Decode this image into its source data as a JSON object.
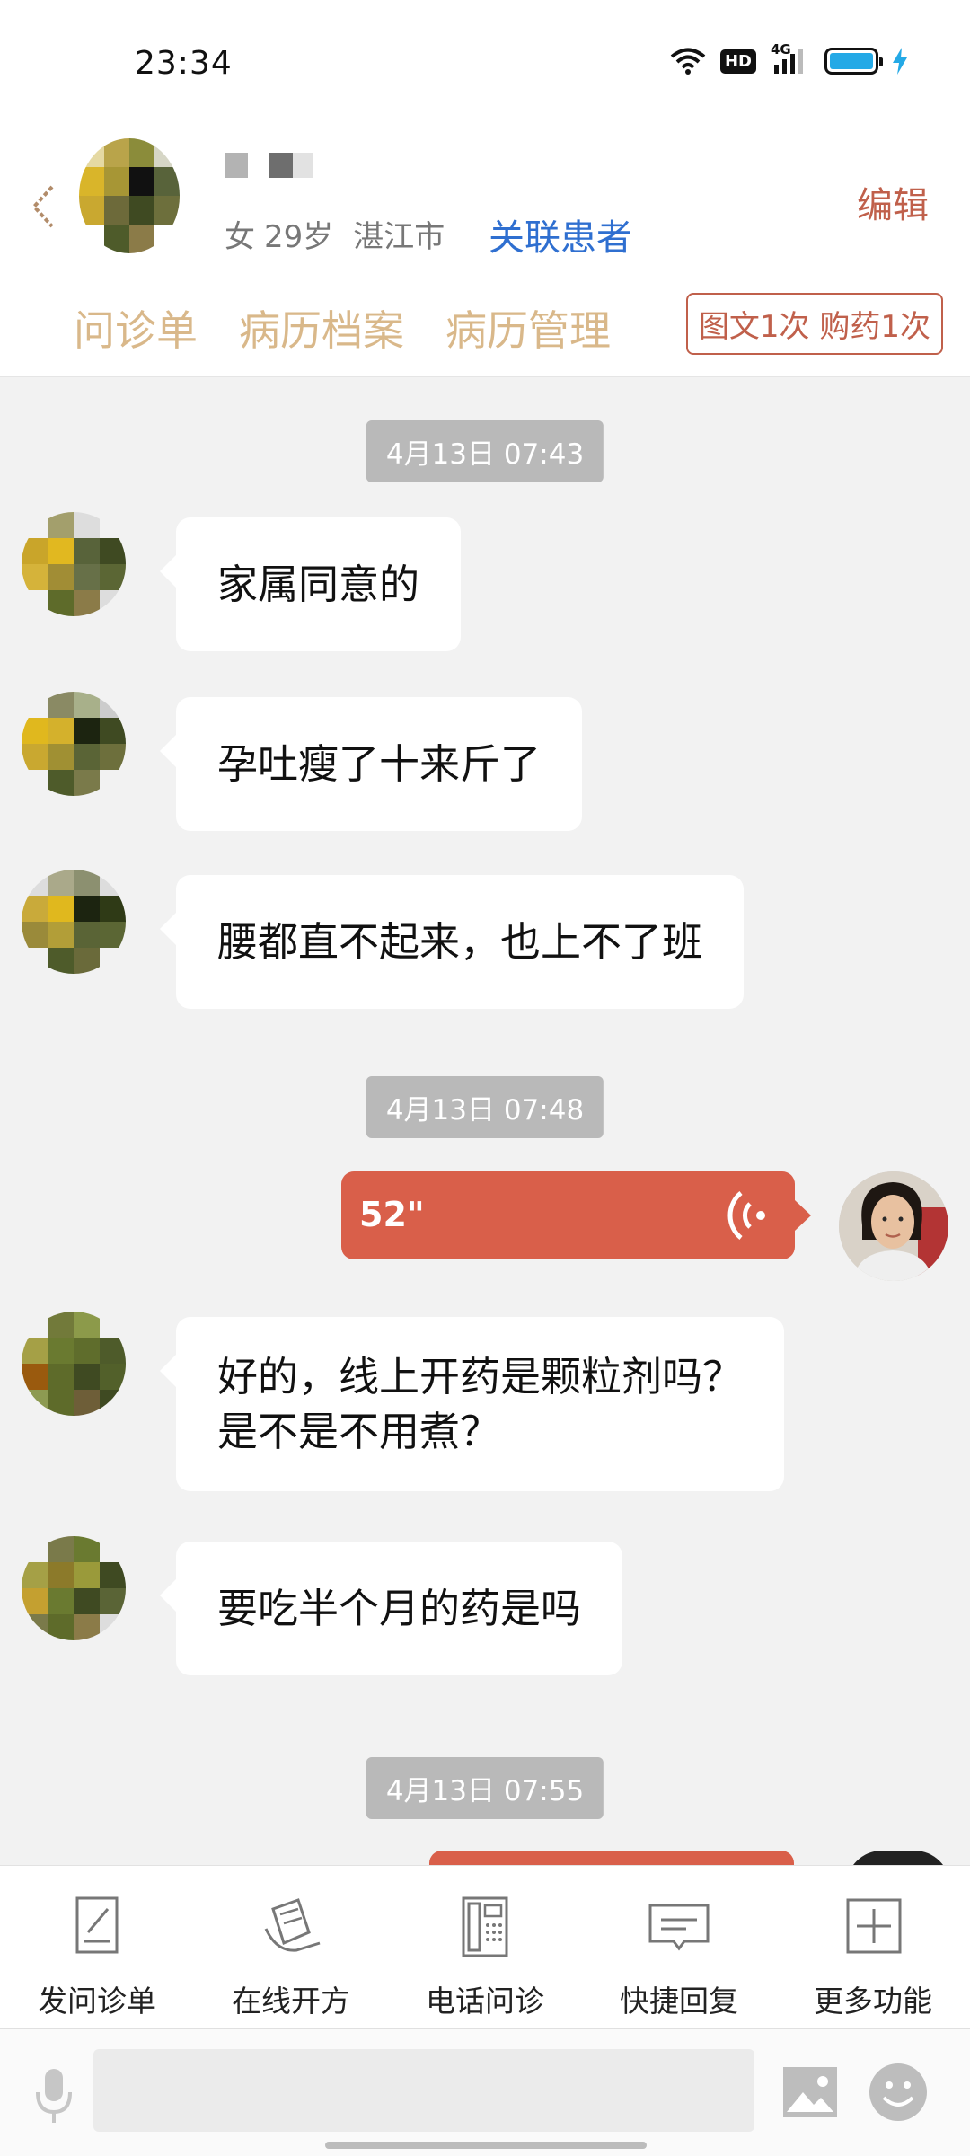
{
  "status_bar": {
    "time": "23:34",
    "hd_label": "HD",
    "network_label": "4G",
    "battery_level": 0.95,
    "battery_color": "#24a9e6"
  },
  "header": {
    "patient_gender": "女",
    "patient_age": "29岁",
    "patient_city": "湛江市",
    "link_patient_label": "关联患者",
    "edit_label": "编辑",
    "tabs": [
      "问诊单",
      "病历档案",
      "病历管理"
    ],
    "quota_label": "图文1次 购药1次"
  },
  "chat": {
    "messages": [
      {
        "timestamp": "4月13日 07:43"
      },
      {
        "text": "家属同意的"
      },
      {
        "text": "孕吐瘦了十来斤了"
      },
      {
        "text": "腰都直不起来，也上不了班"
      },
      {
        "timestamp": "4月13日 07:48"
      },
      {
        "voice_duration": "52\""
      },
      {
        "text": "好的，线上开药是颗粒剂吗？\n是不是不用煮？"
      },
      {
        "text": "要吃半个月的药是吗"
      },
      {
        "timestamp": "4月13日 07:55"
      }
    ]
  },
  "toolbar": {
    "items": [
      {
        "label": "发问诊单",
        "icon": "form-edit-icon"
      },
      {
        "label": "在线开方",
        "icon": "prescription-icon"
      },
      {
        "label": "电话问诊",
        "icon": "phone-icon"
      },
      {
        "label": "快捷回复",
        "icon": "quick-reply-icon"
      },
      {
        "label": "更多功能",
        "icon": "plus-box-icon"
      }
    ]
  },
  "input": {
    "placeholder": ""
  },
  "colors": {
    "accent": "#c0604b",
    "bubble_self": "#d95f4a",
    "tab_text": "#d9b88a",
    "link": "#2f6fd0"
  }
}
